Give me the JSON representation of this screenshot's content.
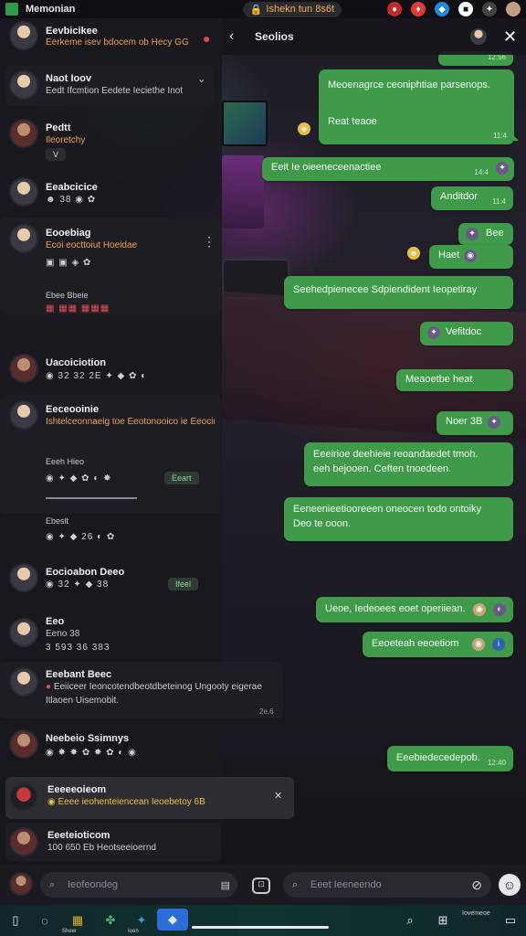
{
  "status_bar": {
    "title": "Memonian",
    "pill": "Ishekn tun 8s6t",
    "icons": [
      "notification-icon",
      "bell-icon",
      "game-icon",
      "shield-icon",
      "network-icon",
      "avatar"
    ]
  },
  "chat_list": [
    {
      "name": "Eevbicikee",
      "preview": "Eerkeme isev bdocem ob Hecy GG Iaosa",
      "extra": ""
    },
    {
      "name": "Naot Ioov",
      "preview": "Eedt Ifcmtion Eedete Ieciethe Inot",
      "extra": ""
    },
    {
      "name": "Pedtt",
      "preview": "Ileoretchy",
      "extra": "V"
    },
    {
      "name": "Eeabcicice",
      "preview": "38",
      "extra": ""
    },
    {
      "name": "Eooebiag",
      "preview": "Ecoi eocttoiut Hoeidae",
      "extra": "Ebee Bbeie"
    },
    {
      "name": "Uacoiciotion",
      "preview": "32  32  2E",
      "extra": ""
    },
    {
      "name": "Eeceooinie",
      "preview": "Ishtelceonnaeig toe Eeotonooico ie Eeocined",
      "extra": "Eeeh Hieo"
    },
    {
      "name": "Ebeslt",
      "preview": "",
      "extra": "Eeart"
    },
    {
      "name": "Eocioabon Deeo",
      "preview": "",
      "extra": "Ifeel"
    },
    {
      "name": "Eeo",
      "preview": "Eeno 38",
      "extra": "3 593  36  383"
    },
    {
      "name": "Eeebant Beec",
      "preview": "Eeiiceer Ieoncotendbeotdbeteinog Ungooty eigerae",
      "extra": "Itlaoen Uisemobit.",
      "time": "2e.6"
    },
    {
      "name": "Neebeio Ssimnys",
      "preview": "",
      "extra": ""
    },
    {
      "name": "Eeeeeoieom",
      "preview": "Eeee ieohenteiencean Ieoebetoy 6B",
      "extra": ""
    },
    {
      "name": "Eeeteioticom",
      "preview": "100 650  Eb Heotseeioernd",
      "extra": ""
    }
  ],
  "chat_header": {
    "title": "Seolios"
  },
  "messages": [
    {
      "text": "",
      "time": "12:56"
    },
    {
      "text": "Meoenagrce ceoniphtiae parsenops.",
      "text2": "Reat teaoe",
      "time": "11:4"
    },
    {
      "text": "Eeit Ie oieeneceenactiee",
      "time": "14:4"
    },
    {
      "text": "Anditdor",
      "time": "11:4"
    },
    {
      "text": "Bee",
      "time": ""
    },
    {
      "text": "Haet",
      "time": ""
    },
    {
      "text": "Seehedpienecee Sdpiendident Ieopetiray",
      "time": ""
    },
    {
      "text": "Vefitdoc",
      "time": ""
    },
    {
      "text": "Meaoetbe heat",
      "time": ""
    },
    {
      "text": "Noer 3B",
      "time": ""
    },
    {
      "text": "Eeeirioe deehieie reoandaedet tmoh.",
      "text2": "eeh bejooen. Ceften tnoedeen.",
      "time": ""
    },
    {
      "text": "Eeneenieetiooreeen oneocen todo ontoiky",
      "text2": "Deo te ooon.",
      "time": ""
    },
    {
      "text": "Ueoe, Iedeoees eoet operiiean.",
      "time": ""
    },
    {
      "text": "Eeoeteah eeoetiom",
      "time": ""
    },
    {
      "text": "Eeebiedecedepob.",
      "time": "12:40"
    }
  ],
  "composer": {
    "left_placeholder": "Ieofeondeg",
    "right_placeholder": "Eeet Ieeneendo"
  },
  "nav": {
    "items": [
      "Sheer",
      "Ioen",
      "Iovemeoe"
    ]
  }
}
